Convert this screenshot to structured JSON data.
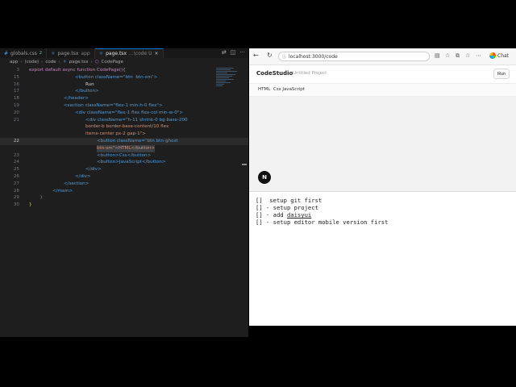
{
  "editor": {
    "tabs": [
      {
        "icon": "#",
        "name": "globals.css",
        "badge": "2",
        "active": false,
        "modified": true
      },
      {
        "icon": "⚛",
        "name": "page.tsx",
        "badge": "app",
        "active": false,
        "modified": false
      },
      {
        "icon": "⚛",
        "name": "page.tsx",
        "badge": "...\\code U",
        "active": true,
        "modified": false
      }
    ],
    "breadcrumb": [
      "app",
      "(code)",
      "code",
      "page.tsx",
      "CodePage"
    ],
    "lines": [
      {
        "n": "3",
        "t": "export default async function CodePage(){"
      },
      {
        "n": "15",
        "t": "<button className=\"btn  btn-sm\">"
      },
      {
        "n": "16",
        "t": "Run"
      },
      {
        "n": "17",
        "t": "</button>"
      },
      {
        "n": "18",
        "t": "</header>"
      },
      {
        "n": "19",
        "t": "<section className=\"flex-1 min-h-0 flex\">"
      },
      {
        "n": "20",
        "t": "<div className=\"flex-1 flex flex-col min-w-0\">"
      },
      {
        "n": "21",
        "t": "<div className=\"h-11 shrink-0 bg-base-200"
      },
      {
        "n": "",
        "t": "border-b border-base-content/10 flex"
      },
      {
        "n": "",
        "t": "items-center px-2 gap-1\">"
      },
      {
        "n": "22",
        "t": "<button className=\"btn btn-ghost"
      },
      {
        "n": "",
        "t": "btn-sm\">HTML</button>"
      },
      {
        "n": "23",
        "t": "<button>Css</button>"
      },
      {
        "n": "24",
        "t": "<button>JavaScript</button>"
      },
      {
        "n": "25",
        "t": "</div>"
      },
      {
        "n": "26",
        "t": "</div>"
      },
      {
        "n": "27",
        "t": "</section>"
      },
      {
        "n": "28",
        "t": "</main>"
      },
      {
        "n": "29",
        "t": ")"
      },
      {
        "n": "30",
        "t": "}"
      }
    ]
  },
  "browser": {
    "url": "localhost:3000/code",
    "chat_label": "Chat",
    "app": {
      "brand": "CodeStudio",
      "project": "Untitled Project",
      "run_label": "Run",
      "langs": [
        "HTML",
        "Css JavaScript"
      ],
      "next_badge": "N"
    },
    "todo": [
      {
        "prefix": "[]  setup git first",
        "under": "",
        "suffix": ""
      },
      {
        "prefix": "[] - setup project",
        "under": "",
        "suffix": ""
      },
      {
        "prefix": "[] - add ",
        "under": "daisyui",
        "suffix": ""
      },
      {
        "prefix": "[] - setup editor mobile version first",
        "under": "",
        "suffix": ""
      }
    ]
  }
}
